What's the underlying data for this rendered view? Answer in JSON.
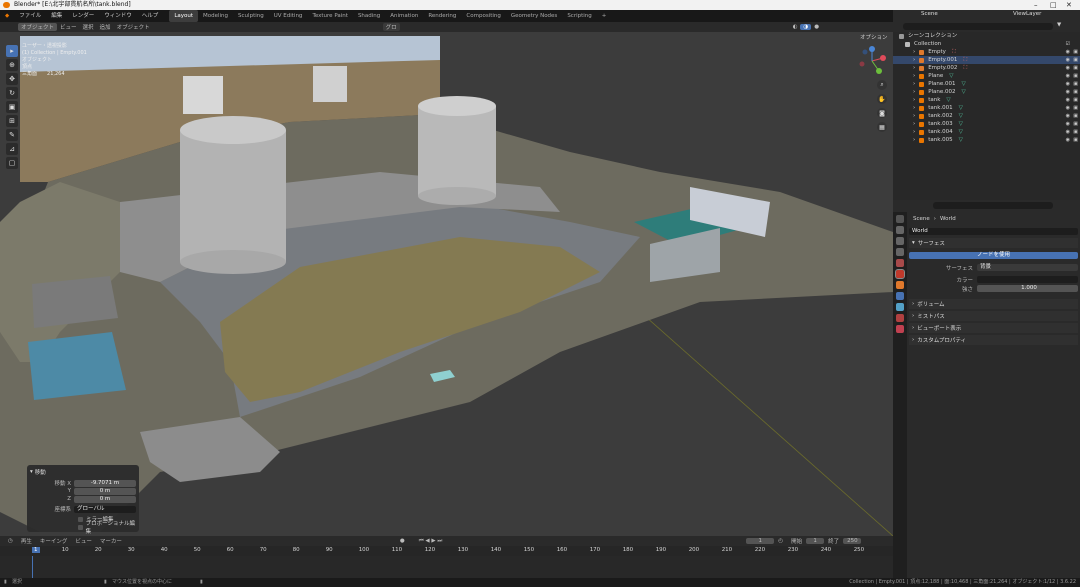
{
  "window": {
    "title": "Blender* [E:\\北宇部貫航名所\\tank.blend]"
  },
  "menu": [
    "ファイル",
    "編集",
    "レンダー",
    "ウィンドウ",
    "ヘルプ"
  ],
  "workspaces": [
    "Layout",
    "Modeling",
    "Sculpting",
    "UV Editing",
    "Texture Paint",
    "Shading",
    "Animation",
    "Rendering",
    "Compositing",
    "Geometry Nodes",
    "Scripting",
    "+"
  ],
  "scene_name": "Scene",
  "view_layer": "ViewLayer",
  "viewport": {
    "mode": "オブジェクト",
    "header_menu": [
      "ビュー",
      "選択",
      "追加",
      "オブジェクト"
    ],
    "transform_orient": "グロ",
    "options_label": "オプション",
    "overlay_lines": [
      "ユーザー・透視投影",
      "(1) Collection | Empty.001",
      "オブジェクト",
      "頂点",
      "三角面",
      "21,264"
    ]
  },
  "last_operator": {
    "title": "移動",
    "rows": [
      {
        "label": "移動 X",
        "value": "-9.7071 m"
      },
      {
        "label": "Y",
        "value": "0 m"
      },
      {
        "label": "Z",
        "value": "0 m"
      }
    ],
    "orient_label": "座標系",
    "orient_value": "グローバル",
    "checks": [
      "ミラー編集",
      "プロポーショナル編集"
    ]
  },
  "timeline": {
    "menu": [
      "再生",
      "キーイング",
      "ビュー",
      "マーカー"
    ],
    "current_frame": "1",
    "start_label": "開始",
    "start": "1",
    "end_label": "終了",
    "end": "250",
    "ticks": [
      "1",
      "10",
      "20",
      "30",
      "40",
      "50",
      "60",
      "70",
      "80",
      "90",
      "100",
      "110",
      "120",
      "130",
      "140",
      "150",
      "160",
      "170",
      "180",
      "190",
      "200",
      "210",
      "220",
      "230",
      "240",
      "250"
    ]
  },
  "statusbar": {
    "left": "選択",
    "middle": "マウス位置を視点の中心に",
    "right": "Collection | Empty.001 | 頂点:12,188 | 面:10,468 | 三角面:21,264 | オブジェクト:1/12 | 3.6.22"
  },
  "outliner": {
    "root": "シーンコレクション",
    "collection": "Collection",
    "items": [
      {
        "name": "Empty",
        "type": "empty",
        "selected": false
      },
      {
        "name": "Empty.001",
        "type": "empty",
        "selected": true
      },
      {
        "name": "Empty.002",
        "type": "empty",
        "selected": false
      },
      {
        "name": "Plane",
        "type": "mesh",
        "selected": false
      },
      {
        "name": "Plane.001",
        "type": "mesh",
        "selected": false
      },
      {
        "name": "Plane.002",
        "type": "mesh",
        "selected": false
      },
      {
        "name": "tank",
        "type": "mesh",
        "selected": false
      },
      {
        "name": "tank.001",
        "type": "mesh",
        "selected": false
      },
      {
        "name": "tank.002",
        "type": "mesh",
        "selected": false
      },
      {
        "name": "tank.003",
        "type": "mesh",
        "selected": false
      },
      {
        "name": "tank.004",
        "type": "mesh",
        "selected": false
      },
      {
        "name": "tank.005",
        "type": "mesh",
        "selected": false
      }
    ]
  },
  "properties": {
    "breadcrumb_scene": "Scene",
    "breadcrumb_world": "World",
    "world_name": "World",
    "surface_panel": "サーフェス",
    "use_nodes": "ノードを使用",
    "surface_label": "サーフェス",
    "surface_value": "背景",
    "color_label": "カラー",
    "strength_label": "強さ",
    "strength_value": "1.000",
    "panels": [
      "ボリューム",
      "ミストパス",
      "ビューポート表示",
      "カスタムプロパティ"
    ]
  },
  "colors": {
    "accent": "#4772b3",
    "selected_row": "#34486b",
    "orange": "#ea7600",
    "mesh": "#53c6a0",
    "empty": "#e0792c"
  }
}
